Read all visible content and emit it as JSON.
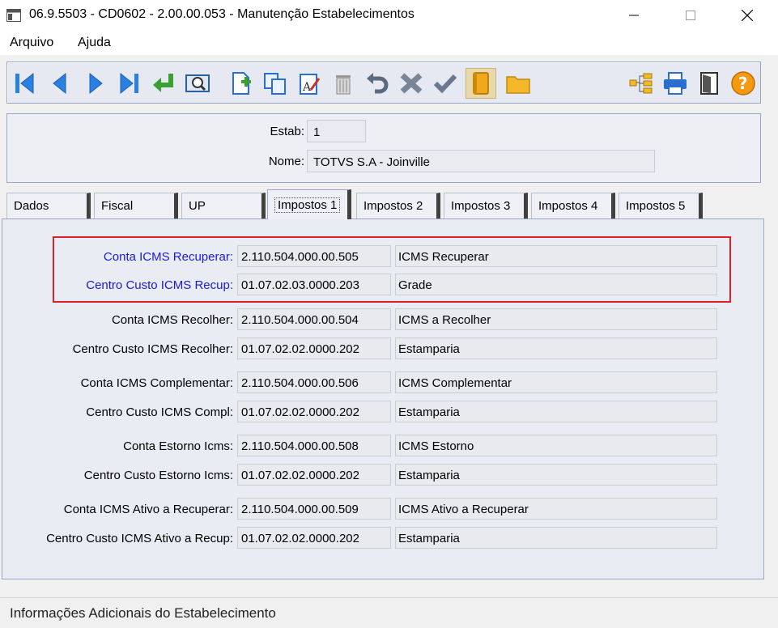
{
  "window": {
    "title": "06.9.5503 - CD0602 - 2.00.00.053 - Manutenção Estabelecimentos"
  },
  "menu": {
    "items": [
      "Arquivo",
      "Ajuda"
    ]
  },
  "toolbar": {
    "buttons": [
      {
        "icon": "first-record-icon"
      },
      {
        "icon": "previous-record-icon"
      },
      {
        "icon": "next-record-icon"
      },
      {
        "icon": "last-record-icon"
      },
      {
        "icon": "go-to-icon"
      },
      {
        "icon": "search-icon"
      },
      {
        "icon": "new-record-icon"
      },
      {
        "icon": "copy-icon"
      },
      {
        "icon": "edit-icon"
      },
      {
        "icon": "delete-icon"
      },
      {
        "icon": "undo-icon"
      },
      {
        "icon": "cancel-icon"
      },
      {
        "icon": "save-icon"
      },
      {
        "icon": "book-icon"
      },
      {
        "icon": "folder-icon"
      },
      {
        "icon": "tree-icon"
      },
      {
        "icon": "print-icon"
      },
      {
        "icon": "exit-icon"
      },
      {
        "icon": "help-icon"
      }
    ]
  },
  "header": {
    "estab_label": "Estab:",
    "estab_value": "1",
    "nome_label": "Nome:",
    "nome_value": "TOTVS S.A - Joinville"
  },
  "tabs": [
    {
      "label": "Dados"
    },
    {
      "label": "Fiscal"
    },
    {
      "label": "UP"
    },
    {
      "label": "Impostos 1",
      "active": true
    },
    {
      "label": "Impostos 2"
    },
    {
      "label": "Impostos 3"
    },
    {
      "label": "Impostos 4"
    },
    {
      "label": "Impostos 5"
    }
  ],
  "rows": [
    {
      "label": "Conta ICMS Recuperar:",
      "code": "2.110.504.000.00.505",
      "desc": "ICMS Recuperar",
      "link": true
    },
    {
      "label": "Centro Custo ICMS Recup:",
      "code": "01.07.02.03.0000.203",
      "desc": "Grade",
      "link": true
    },
    {
      "label": "Conta ICMS Recolher:",
      "code": "2.110.504.000.00.504",
      "desc": "ICMS a Recolher"
    },
    {
      "label": "Centro Custo ICMS Recolher:",
      "code": "01.07.02.02.0000.202",
      "desc": "Estamparia"
    },
    {
      "label": "Conta ICMS Complementar:",
      "code": "2.110.504.000.00.506",
      "desc": "ICMS Complementar"
    },
    {
      "label": "Centro Custo ICMS Compl:",
      "code": "01.07.02.02.0000.202",
      "desc": "Estamparia"
    },
    {
      "label": "Conta Estorno Icms:",
      "code": "2.110.504.000.00.508",
      "desc": "ICMS Estorno"
    },
    {
      "label": "Centro Custo Estorno Icms:",
      "code": "01.07.02.02.0000.202",
      "desc": "Estamparia"
    },
    {
      "label": "Conta ICMS Ativo a Recuperar:",
      "code": "2.110.504.000.00.509",
      "desc": "ICMS Ativo a Recuperar"
    },
    {
      "label": "Centro Custo ICMS Ativo a Recup:",
      "code": "01.07.02.02.0000.202",
      "desc": "Estamparia"
    }
  ],
  "status": {
    "text": "Informações Adicionais do Estabelecimento"
  },
  "colors": {
    "link_label": "#1a1adc",
    "highlight_border": "#e0202a",
    "panel_border": "#9aa7c4"
  }
}
